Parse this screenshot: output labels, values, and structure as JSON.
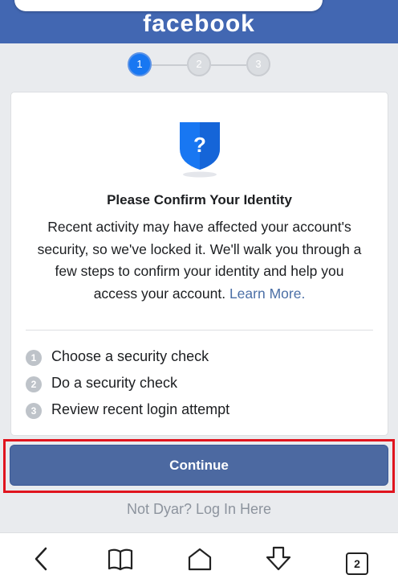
{
  "header": {
    "logo_text": "facebook",
    "brand_color": "#4267b2"
  },
  "stepper": {
    "steps": [
      "1",
      "2",
      "3"
    ],
    "active_step": 1
  },
  "card": {
    "icon": "shield-question-icon",
    "title": "Please Confirm Your Identity",
    "body_text": "Recent activity may have affected your account's security, so we've locked it. We'll walk you through a few steps to confirm your identity and help you access your account.",
    "learn_more": "Learn More.",
    "checklist": [
      {
        "number": "1",
        "label": "Choose a security check"
      },
      {
        "number": "2",
        "label": "Do a security check"
      },
      {
        "number": "3",
        "label": "Review recent login attempt"
      }
    ]
  },
  "actions": {
    "continue_label": "Continue",
    "not_user_link": "Not Dyar? Log In Here"
  },
  "browser_nav": {
    "tab_count": "2",
    "icons": [
      "back-icon",
      "bookmarks-icon",
      "home-icon",
      "download-icon",
      "tabs-icon"
    ]
  }
}
